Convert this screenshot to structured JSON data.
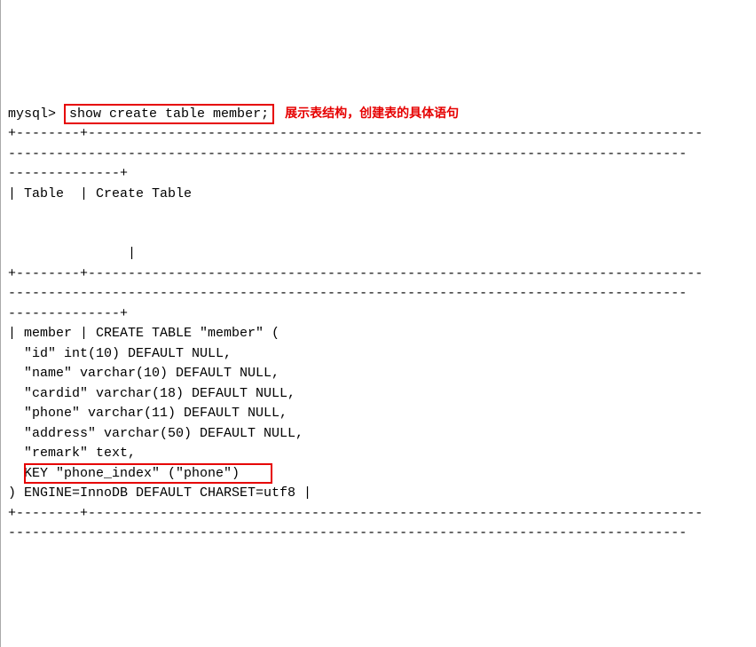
{
  "prompt": "mysql>",
  "command": "show create table member;",
  "annotation": "展示表结构，创建表的具体语句",
  "sep_top1": "+--------+-----------------------------------------------------------------------------",
  "sep_dash1": "-------------------------------------------------------------------------------------",
  "sep_dash2": "--------------+",
  "header_row": "| Table  | Create Table",
  "header_pipe": "               |",
  "sep_top2": "+--------+-----------------------------------------------------------------------------",
  "sep_dash3": "-------------------------------------------------------------------------------------",
  "sep_dash4": "--------------+",
  "body_line1": "| member | CREATE TABLE \"member\" (",
  "body_line2": "  \"id\" int(10) DEFAULT NULL,",
  "body_line3": "  \"name\" varchar(10) DEFAULT NULL,",
  "body_line4": "  \"cardid\" varchar(18) DEFAULT NULL,",
  "body_line5": "  \"phone\" varchar(11) DEFAULT NULL,",
  "body_line6": "  \"address\" varchar(50) DEFAULT NULL,",
  "body_line7": "  \"remark\" text,",
  "body_line8": "  KEY \"phone_index\" (\"phone\")",
  "body_line9": ") ENGINE=InnoDB DEFAULT CHARSET=utf8 |",
  "sep_bot1": "+--------+-----------------------------------------------------------------------------",
  "sep_dash5": "-------------------------------------------------------------------------------------"
}
